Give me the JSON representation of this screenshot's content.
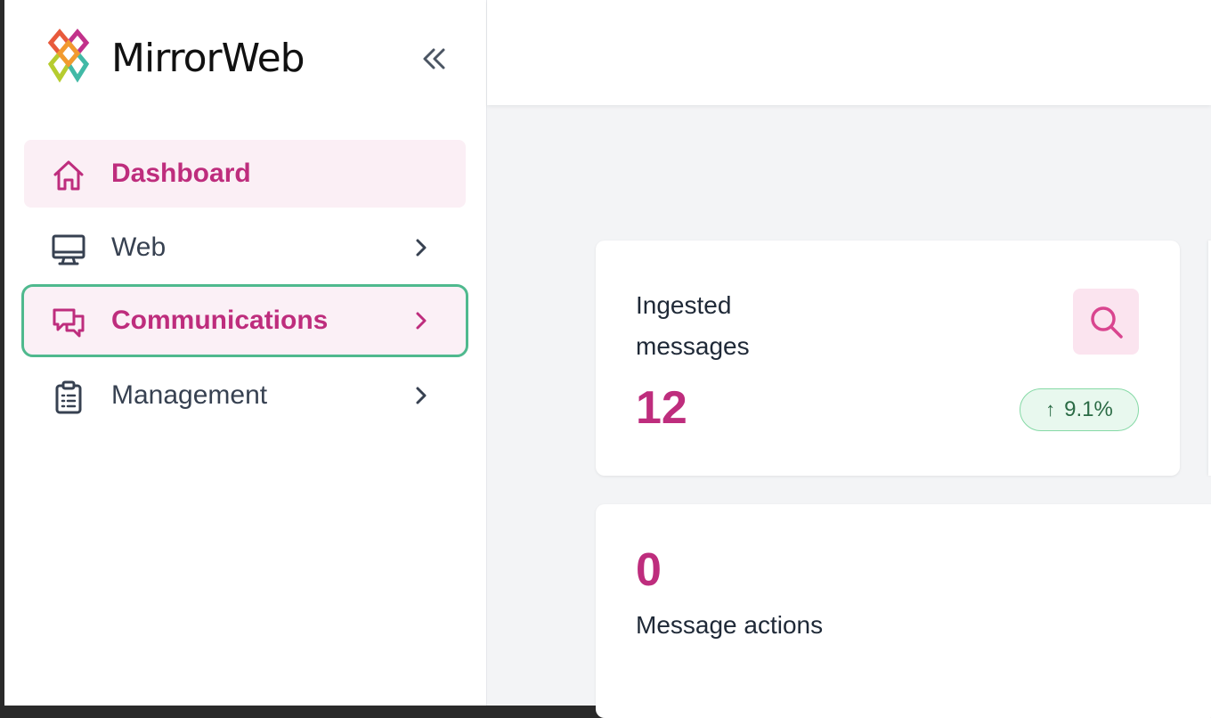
{
  "brand": {
    "name": "MirrorWeb"
  },
  "sidebar": {
    "collapse_icon": "double-chevron-left-icon",
    "items": [
      {
        "label": "Dashboard",
        "icon": "home-icon",
        "state": "active",
        "has_chevron": false
      },
      {
        "label": "Web",
        "icon": "monitor-icon",
        "state": "default",
        "has_chevron": true
      },
      {
        "label": "Communications",
        "icon": "chat-bubbles-icon",
        "state": "focused",
        "has_chevron": true
      },
      {
        "label": "Management",
        "icon": "clipboard-icon",
        "state": "default",
        "has_chevron": true
      }
    ]
  },
  "cards": {
    "ingested": {
      "title": "Ingested messages",
      "value": "12",
      "trend": "9.1%",
      "trend_direction": "up",
      "action_icon": "search-icon"
    },
    "actions": {
      "value": "0",
      "label": "Message actions"
    }
  },
  "colors": {
    "accent": "#be2d7d",
    "active_bg": "#fbeff5",
    "focus_outline": "#4fb98e",
    "trend_bg": "#e8f8ee",
    "trend_border": "#86d9a6"
  }
}
